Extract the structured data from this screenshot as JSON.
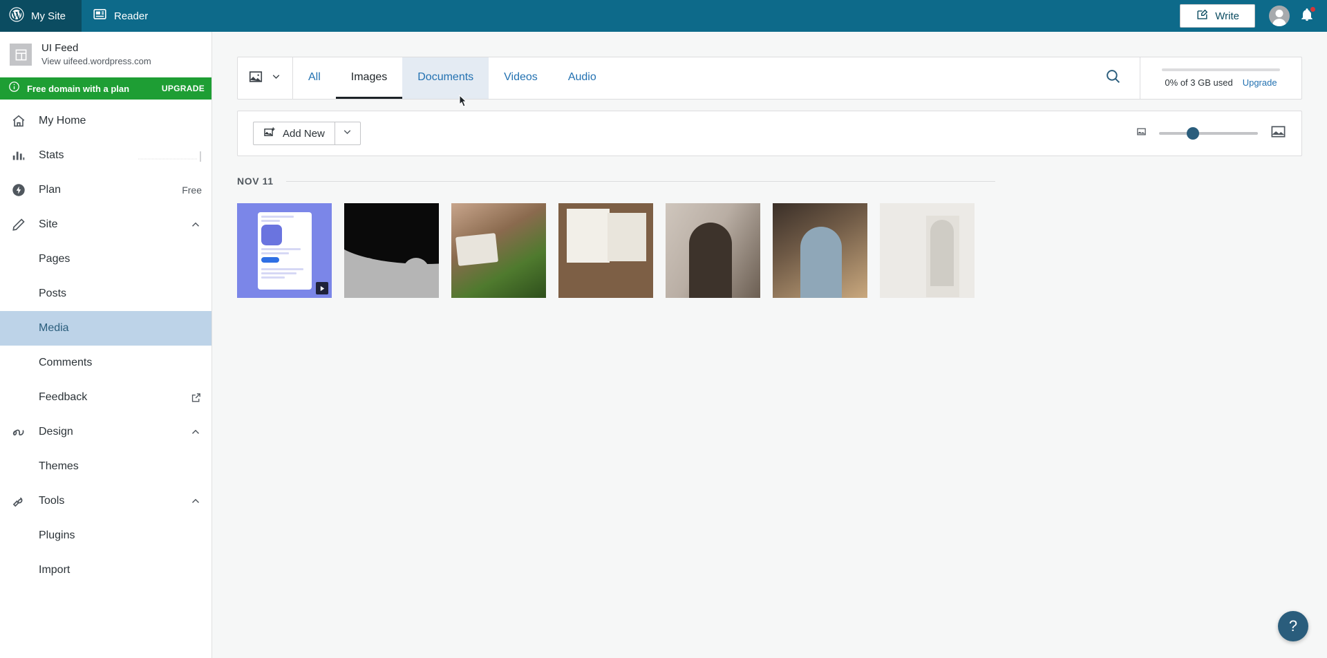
{
  "masthead": {
    "my_site_label": "My Site",
    "reader_label": "Reader",
    "write_label": "Write",
    "wordpress_icon": "wordpress-logo-icon",
    "reader_icon": "reader-feed-icon",
    "write_icon": "write-pencil-icon",
    "avatar_icon": "user-avatar-icon",
    "bell_icon": "notifications-bell-icon",
    "bg_color": "#0d6a8a",
    "my_site_bg_color": "#0b4c61",
    "notification_dot_color": "#d63638"
  },
  "sidebar": {
    "site_name": "UI Feed",
    "site_url": "View uifeed.wordpress.com",
    "site_thumb_icon": "site-layout-icon",
    "banner": {
      "icon": "info-circle-icon",
      "text": "Free domain with a plan",
      "cta": "UPGRADE",
      "bg_color": "#1e9e34"
    },
    "items": [
      {
        "label": "My Home",
        "icon": "home-icon",
        "type": "top",
        "right": ""
      },
      {
        "label": "Stats",
        "icon": "bar-chart-icon",
        "type": "top",
        "right": ""
      },
      {
        "label": "Plan",
        "icon": "plan-bolt-icon",
        "type": "top",
        "right": "Free"
      },
      {
        "label": "Site",
        "icon": "pencil-icon",
        "type": "top",
        "right": "",
        "expanded": true
      },
      {
        "label": "Pages",
        "icon": "",
        "type": "sub",
        "right": ""
      },
      {
        "label": "Posts",
        "icon": "",
        "type": "sub",
        "right": ""
      },
      {
        "label": "Media",
        "icon": "",
        "type": "sub",
        "right": "",
        "active": true
      },
      {
        "label": "Comments",
        "icon": "",
        "type": "sub",
        "right": ""
      },
      {
        "label": "Feedback",
        "icon": "",
        "type": "sub",
        "right": "",
        "external": true
      },
      {
        "label": "Design",
        "icon": "design-icon",
        "type": "top",
        "right": "",
        "expanded": true
      },
      {
        "label": "Themes",
        "icon": "",
        "type": "sub",
        "right": ""
      },
      {
        "label": "Tools",
        "icon": "wrench-icon",
        "type": "top",
        "right": "",
        "expanded": true
      },
      {
        "label": "Plugins",
        "icon": "",
        "type": "sub",
        "right": ""
      },
      {
        "label": "Import",
        "icon": "",
        "type": "sub",
        "right": ""
      }
    ],
    "active_item": "Media",
    "active_bg_color": "#bdd3e8",
    "active_text_color": "#2a5d7c"
  },
  "media": {
    "filter": {
      "type_icon": "image-filter-icon",
      "type_caret_icon": "chevron-down-icon",
      "tabs": [
        {
          "label": "All",
          "state": "default"
        },
        {
          "label": "Images",
          "state": "active"
        },
        {
          "label": "Documents",
          "state": "hovered"
        },
        {
          "label": "Videos",
          "state": "default"
        },
        {
          "label": "Audio",
          "state": "default"
        }
      ],
      "search_icon": "search-icon",
      "link_color": "#2271b1",
      "active_color": "#1d2327",
      "hover_bg_color": "#e4ebf3"
    },
    "storage": {
      "used_text": "0% of 3 GB used",
      "upgrade_label": "Upgrade",
      "percent": 0
    },
    "actions": {
      "add_new_label": "Add New",
      "add_new_icon": "add-image-icon",
      "add_new_caret_icon": "chevron-down-icon",
      "zoom_small_icon": "small-thumbnails-icon",
      "zoom_large_icon": "large-thumbnails-icon",
      "zoom_value": 30
    },
    "groups": [
      {
        "date_label": "NOV 11",
        "items": [
          {
            "name": "app-store-screenshot",
            "art": "t1",
            "badge": "video-play-icon"
          },
          {
            "name": "abstract-black-shape",
            "art": "t2",
            "badge": ""
          },
          {
            "name": "woman-with-tablet",
            "art": "t3",
            "badge": ""
          },
          {
            "name": "desk-flatlay-newspaper",
            "art": "t4",
            "badge": ""
          },
          {
            "name": "woman-at-laptop",
            "art": "t5",
            "badge": ""
          },
          {
            "name": "woman-on-phone-at-cafe",
            "art": "t6",
            "badge": ""
          },
          {
            "name": "person-writing-whiteboard",
            "art": "t7",
            "badge": ""
          }
        ]
      }
    ]
  },
  "help": {
    "icon": "help-question-icon",
    "label": "?",
    "bg_color": "#2a5d7c"
  }
}
